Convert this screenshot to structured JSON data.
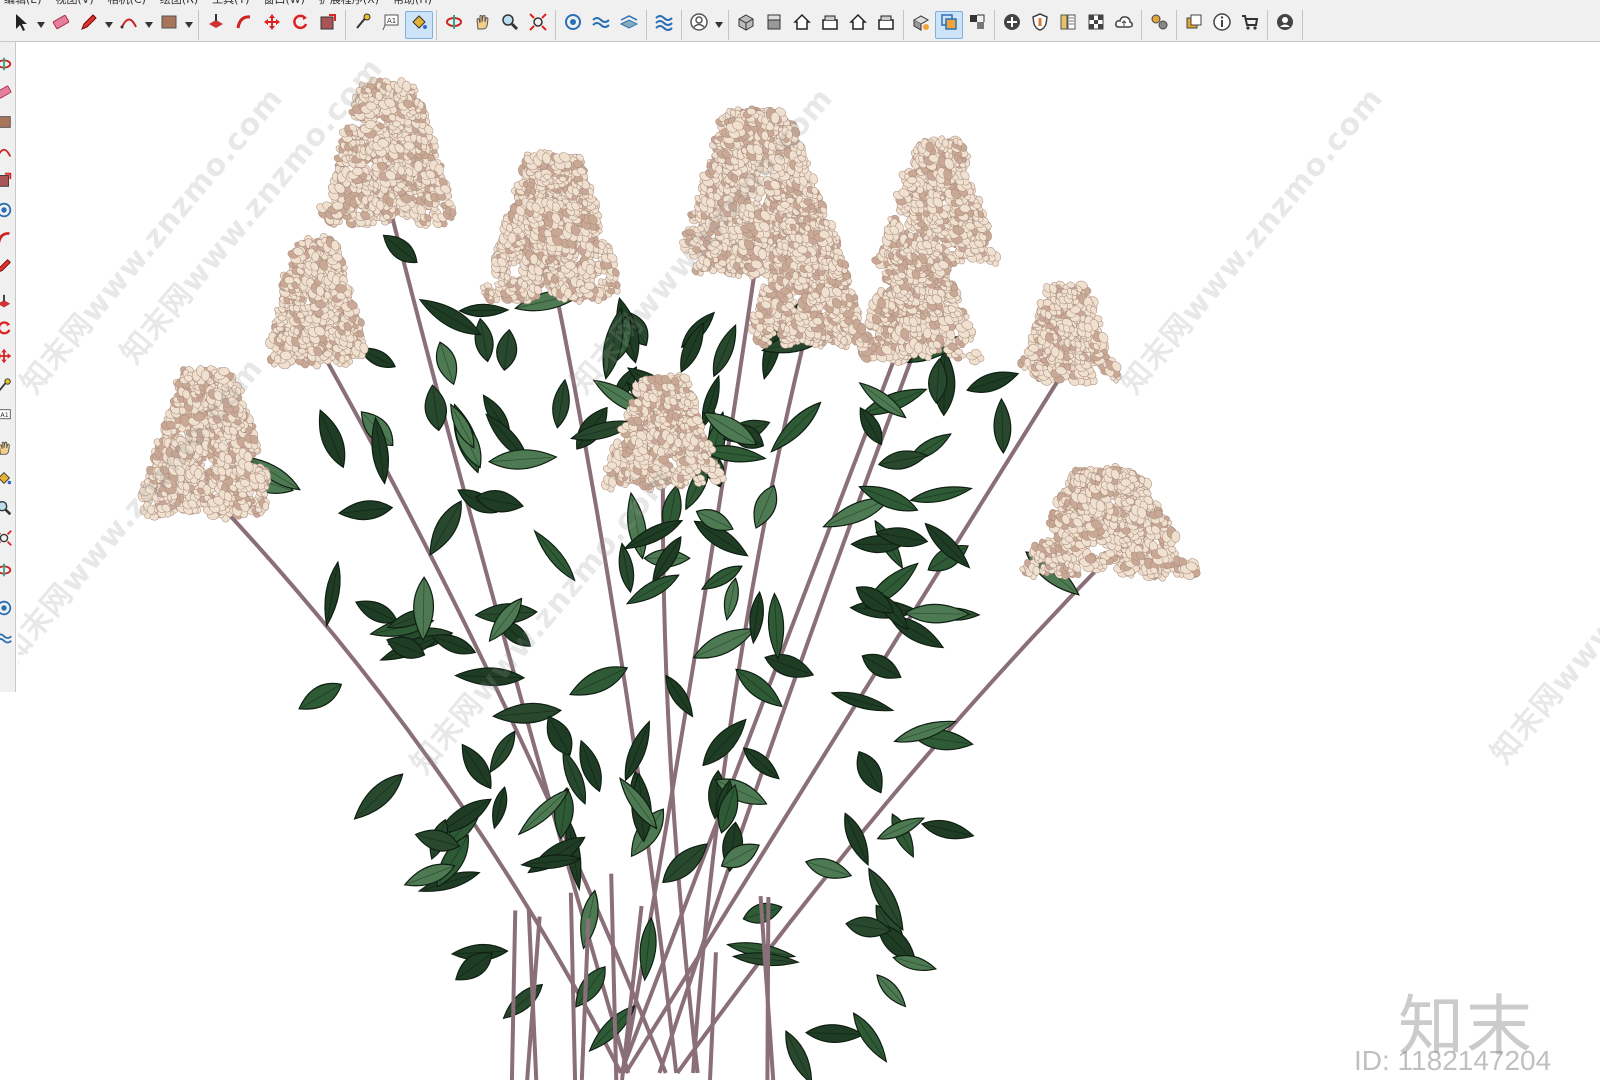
{
  "menu": [
    "编辑(E)",
    "视图(V)",
    "相机(C)",
    "绘图(R)",
    "工具(T)",
    "窗口(W)",
    "扩展程序(X)",
    "帮助(H)"
  ],
  "toolbar": {
    "groups": [
      [
        "select-icon",
        "eraser-icon",
        "pencil-icon",
        "arc-icon",
        "rectangle-icon"
      ],
      [
        "push-pull-icon",
        "follow-me-icon",
        "move-icon",
        "rotate-icon",
        "scale-icon"
      ],
      [
        "tape-measure-icon",
        "text-icon",
        "paint-bucket-icon"
      ],
      [
        "orbit-icon",
        "pan-icon",
        "zoom-icon",
        "zoom-extents-icon"
      ],
      [
        "sandbox-icon",
        "smoove-icon",
        "stamp-icon"
      ],
      [
        "drape-icon"
      ],
      [
        "user-icon"
      ],
      [
        "iso-view-icon",
        "top-view-icon",
        "front-view-icon",
        "right-view-icon",
        "back-view-icon",
        "left-view-icon"
      ],
      [
        "styles-icon",
        "x-ray-icon",
        "section-icon"
      ],
      [
        "add-location-icon",
        "shield-icon",
        "materials-icon",
        "checker-icon",
        "cloud-icon"
      ],
      [
        "extensions-icon"
      ],
      [
        "layout-icon",
        "info-icon",
        "cart-icon"
      ],
      [
        "account-icon"
      ]
    ],
    "active": [
      "paint-bucket-icon",
      "x-ray-icon"
    ]
  },
  "watermark": {
    "text": "知末网www.znzmo.com",
    "brand": "知末",
    "id_label": "ID: 1182147204"
  },
  "colors": {
    "leaf_dark": "#1e3d24",
    "leaf_mid": "#2f5a36",
    "leaf_light": "#4d7a52",
    "stem": "#8a6f78",
    "flower": "#f0e0cf",
    "flower_shade": "#c9a996"
  }
}
